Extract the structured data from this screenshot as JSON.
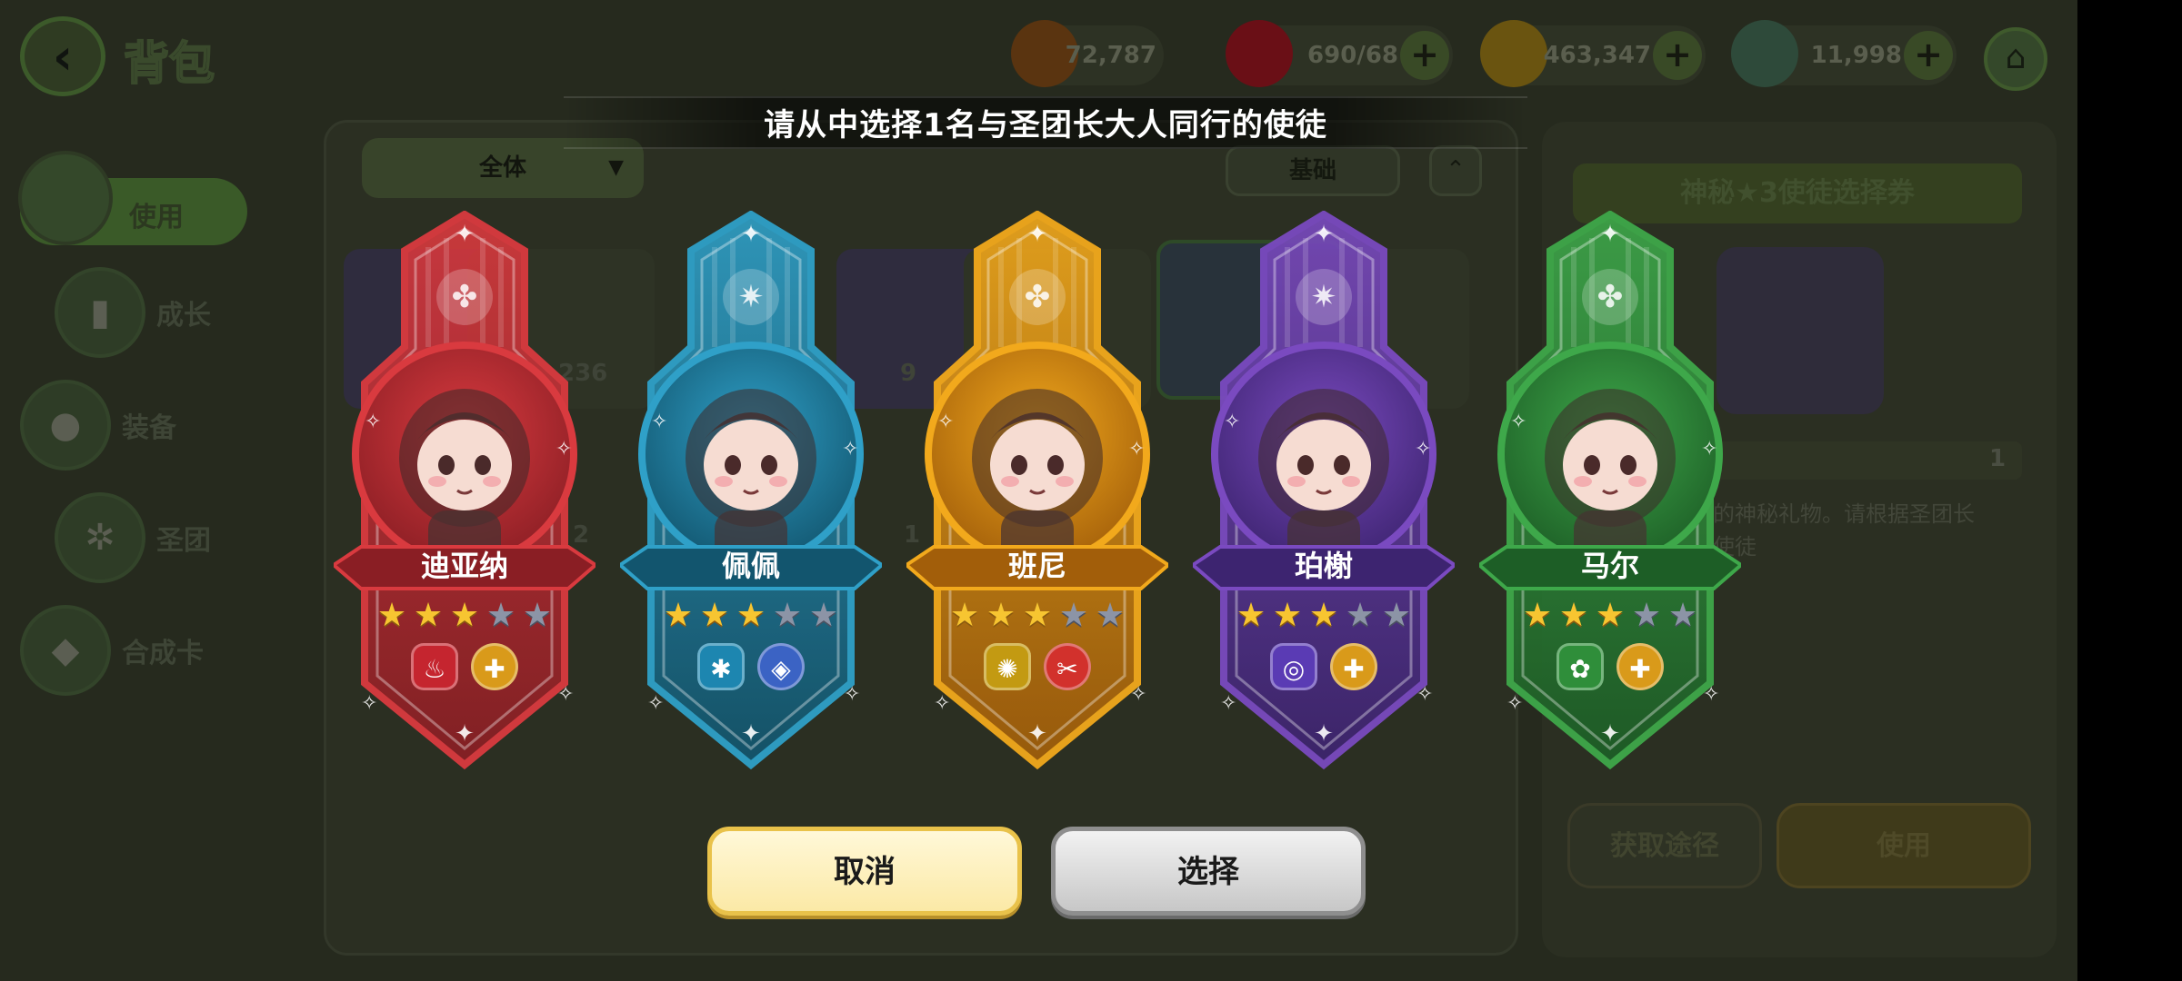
{
  "header": {
    "title": "背包",
    "resources": [
      {
        "name": "food",
        "value": "72,787",
        "color": "#8a4a14",
        "has_plus": false
      },
      {
        "name": "ruby",
        "value": "690/68",
        "color": "#a2141e",
        "has_plus": true
      },
      {
        "name": "gold",
        "value": "463,347",
        "color": "#a78214",
        "has_plus": true
      },
      {
        "name": "leaf",
        "value": "11,998",
        "color": "#4a7a5a",
        "has_plus": true
      }
    ],
    "plus_label": "+",
    "back_label": "‹",
    "home_label": "⌂"
  },
  "sidebar": {
    "items": [
      {
        "label": "使用",
        "icon": "chest-icon",
        "active": true
      },
      {
        "label": "成长",
        "icon": "book-icon"
      },
      {
        "label": "装备",
        "icon": "bag-icon"
      },
      {
        "label": "圣团",
        "icon": "cog-icon"
      },
      {
        "label": "合成卡",
        "icon": "card-icon"
      }
    ]
  },
  "inventory": {
    "filter": "全体",
    "sort": "基础",
    "counts": [
      "236",
      "9",
      "2",
      "1"
    ]
  },
  "item_info": {
    "name": "神秘★3使徒选择券",
    "count": "1",
    "description": "的神秘礼物。请根据圣团长\n使徒",
    "source_button": "获取途径",
    "use_button": "使用"
  },
  "modal": {
    "title": "请从中选择1名与圣团长大人同行的使徒",
    "cancel": "取消",
    "select": "选择",
    "characters": [
      {
        "name": "迪亚纳",
        "stars": 3,
        "max_stars": 5,
        "theme": "#d93a3f",
        "dark": "#8a1e24",
        "emblem": "paw-icon",
        "tags": [
          {
            "icon": "flame-icon",
            "glyph": "♨",
            "color": "#c5252f",
            "shape": "pent"
          },
          {
            "icon": "cross-icon",
            "glyph": "✚",
            "color": "#d99a1a",
            "shape": "round"
          }
        ]
      },
      {
        "name": "佩佩",
        "stars": 3,
        "max_stars": 5,
        "theme": "#2fa0c8",
        "dark": "#12556e",
        "emblem": "star-burst-icon",
        "tags": [
          {
            "icon": "snowflake-icon",
            "glyph": "✱",
            "color": "#1d86b0",
            "shape": "pent"
          },
          {
            "icon": "shield-icon",
            "glyph": "◈",
            "color": "#3b63c4",
            "shape": "round"
          }
        ]
      },
      {
        "name": "班尼",
        "stars": 3,
        "max_stars": 5,
        "theme": "#f2a91c",
        "dark": "#a25e0a",
        "emblem": "paw-icon",
        "tags": [
          {
            "icon": "sun-icon",
            "glyph": "✺",
            "color": "#c39a12",
            "shape": "pent"
          },
          {
            "icon": "tools-icon",
            "glyph": "✂",
            "color": "#d2312c",
            "shape": "round"
          }
        ]
      },
      {
        "name": "珀榭",
        "stars": 3,
        "max_stars": 5,
        "theme": "#7a4ac0",
        "dark": "#3d2470",
        "emblem": "star-burst-icon",
        "tags": [
          {
            "icon": "swirl-icon",
            "glyph": "◎",
            "color": "#5a3bb4",
            "shape": "pent"
          },
          {
            "icon": "cross-icon",
            "glyph": "✚",
            "color": "#d99a1a",
            "shape": "round"
          }
        ]
      },
      {
        "name": "马尔",
        "stars": 3,
        "max_stars": 5,
        "theme": "#3ea84a",
        "dark": "#1d5e26",
        "emblem": "paw-icon",
        "tags": [
          {
            "icon": "clover-icon",
            "glyph": "✿",
            "color": "#2f8e3a",
            "shape": "pent"
          },
          {
            "icon": "cross-icon",
            "glyph": "✚",
            "color": "#d99a1a",
            "shape": "round"
          }
        ]
      }
    ]
  }
}
